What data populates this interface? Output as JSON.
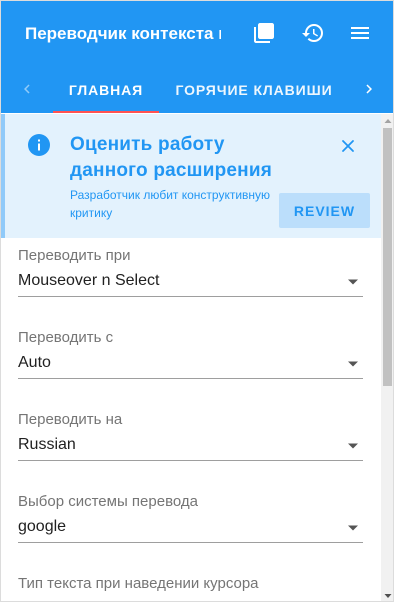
{
  "header": {
    "title": "Переводчик контекста м",
    "icons": [
      "library-icon",
      "history-icon",
      "menu-icon"
    ],
    "color": "#2196f3"
  },
  "tabs": {
    "items": [
      {
        "label": "ГЛАВНАЯ",
        "active": true
      },
      {
        "label": "ГОРЯЧИЕ КЛАВИШИ",
        "active": false
      }
    ],
    "indicator_color": "#ff5252"
  },
  "banner": {
    "title": "Оценить работу данного расширения",
    "subtitle": "Разработчик любит конструктивную критику",
    "button_label": "REVIEW",
    "background": "#e3f2fd"
  },
  "fields": [
    {
      "label": "Переводить при",
      "value": "Mouseover n Select"
    },
    {
      "label": "Переводить с",
      "value": "Auto"
    },
    {
      "label": "Переводить на",
      "value": "Russian"
    },
    {
      "label": "Выбор системы перевода",
      "value": "google"
    },
    {
      "label": "Тип текста при наведении курсора",
      "value": ""
    }
  ]
}
